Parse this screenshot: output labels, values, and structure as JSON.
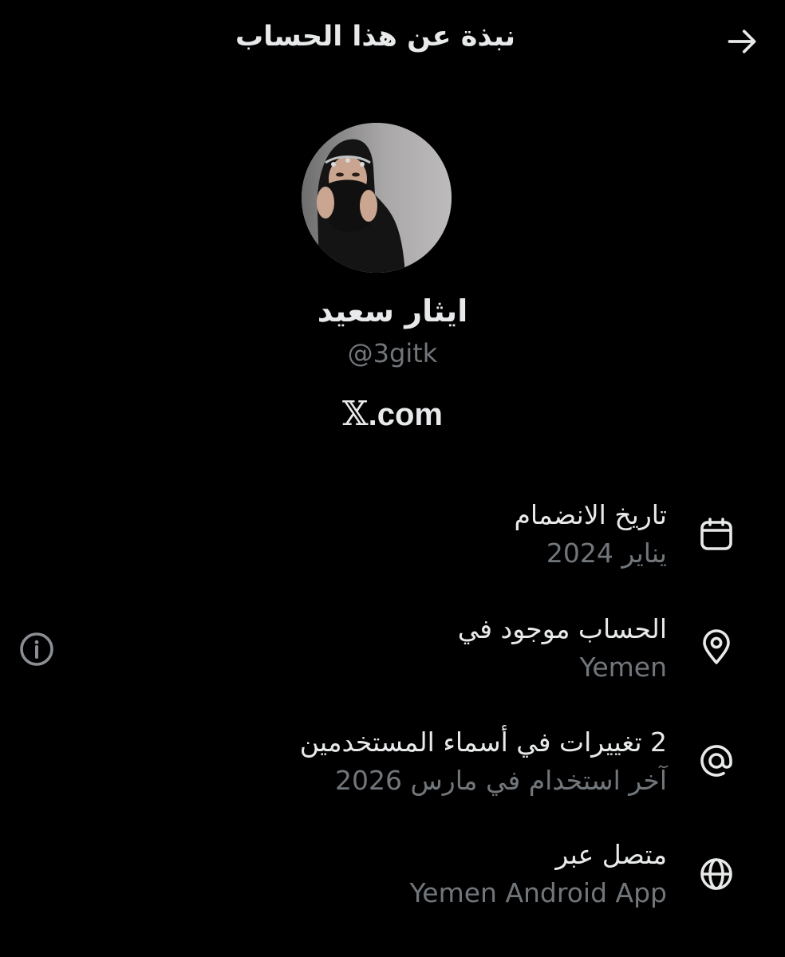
{
  "header": {
    "title": "نبذة عن هذا الحساب",
    "back_icon": "arrow-right-icon"
  },
  "profile": {
    "display_name": "ايثار سعيد",
    "handle": "@3gitk",
    "brand_x": "𝕏",
    "brand_rest": ".com"
  },
  "details": [
    {
      "icon": "calendar-icon",
      "label": "تاريخ الانضمام",
      "value": "يناير 2024"
    },
    {
      "icon": "location-pin-icon",
      "label": "الحساب موجود في",
      "value": "Yemen"
    },
    {
      "icon": "at-sign-icon",
      "label": "2 تغييرات في أسماء المستخدمين",
      "value": "آخر استخدام في مارس 2026"
    },
    {
      "icon": "globe-icon",
      "label": "متصل عبر",
      "value": "Yemen Android App"
    }
  ],
  "info_icon": "info-circle-icon",
  "colors": {
    "background": "#000000",
    "primary_text": "#e7e9ea",
    "secondary_text": "#71767b"
  }
}
